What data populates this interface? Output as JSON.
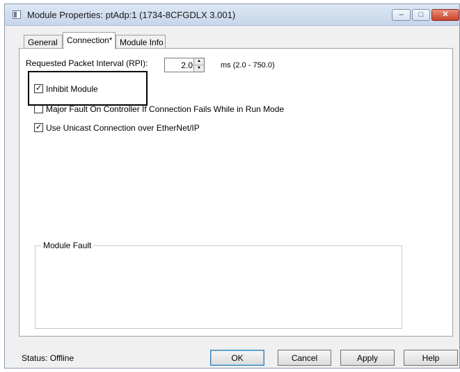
{
  "window": {
    "title": "Module Properties: ptAdp:1 (1734-8CFGDLX 3.001)",
    "controls": {
      "minimize": "–",
      "maximize": "□",
      "close": "✕"
    }
  },
  "tabs": [
    {
      "label": "General",
      "active": false
    },
    {
      "label": "Connection*",
      "active": true
    },
    {
      "label": "Module Info",
      "active": false
    }
  ],
  "connection": {
    "rpi_label": "Requested Packet Interval (RPI):",
    "rpi_value": "2.0",
    "rpi_units": "ms (2.0 - 750.0)",
    "spin_up": "▲",
    "spin_down": "▼",
    "inhibit_label": "Inhibit Module",
    "inhibit_checked": true,
    "major_fault_label": "Major Fault On Controller If Connection Fails While in Run Mode",
    "major_fault_checked": false,
    "unicast_label": "Use Unicast Connection over EtherNet/IP",
    "unicast_checked": true,
    "module_fault_label": "Module Fault"
  },
  "footer": {
    "status": "Status:  Offline",
    "ok": "OK",
    "cancel": "Cancel",
    "apply": "Apply",
    "help": "Help"
  }
}
